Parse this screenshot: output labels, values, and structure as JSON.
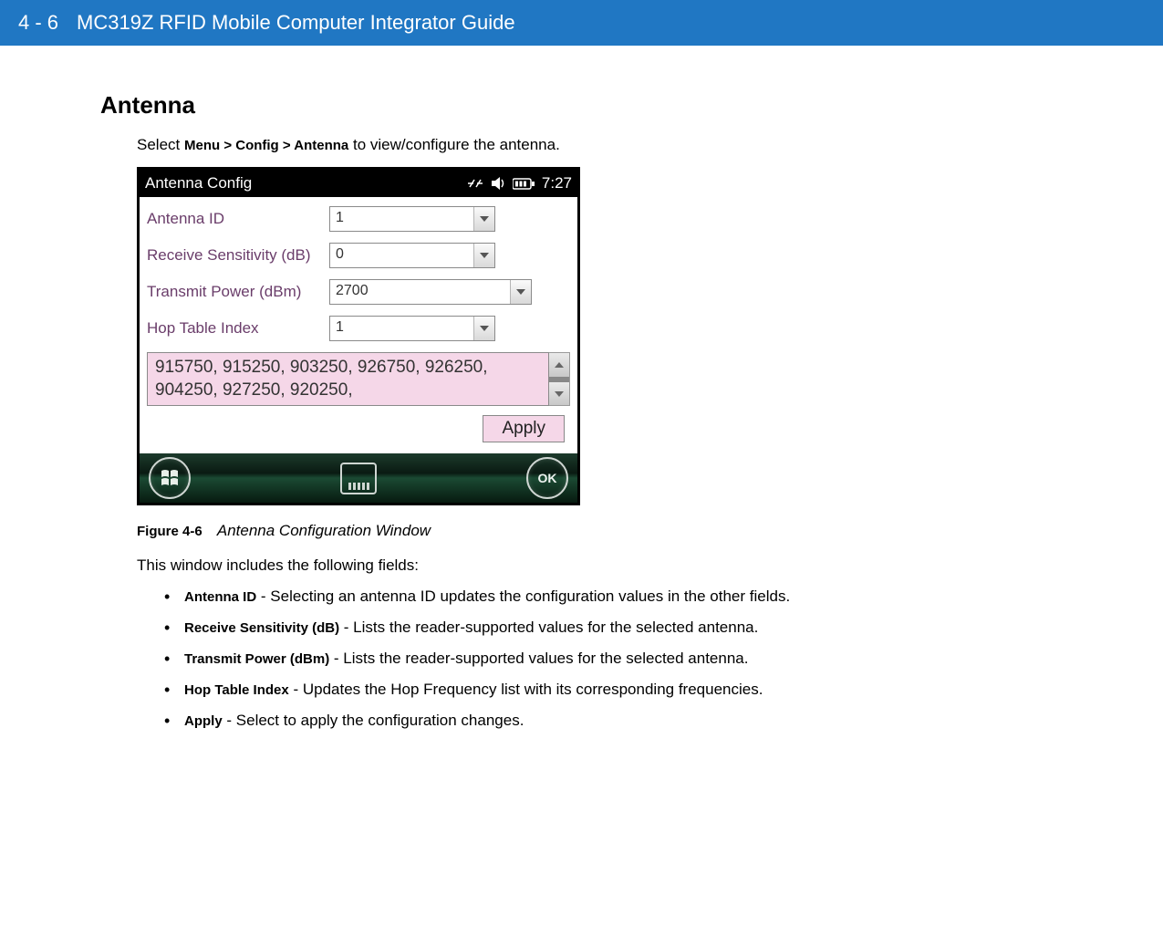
{
  "header": {
    "page": "4 - 6",
    "title": "MC319Z RFID Mobile Computer Integrator Guide"
  },
  "section": {
    "title": "Antenna",
    "intro_prefix": "Select ",
    "intro_bold": "Menu > Config > Antenna",
    "intro_suffix": " to view/configure the antenna."
  },
  "screenshot": {
    "window_title": "Antenna Config",
    "clock": "7:27",
    "fields": {
      "antenna_id": {
        "label": "Antenna ID",
        "value": "1"
      },
      "receive_sens": {
        "label": "Receive Sensitivity (dB)",
        "value": "0"
      },
      "tx_power": {
        "label": "Transmit Power (dBm)",
        "value": "2700"
      },
      "hop_index": {
        "label": "Hop Table Index",
        "value": "1"
      }
    },
    "freq_list": "915750, 915250, 903250, 926750, 926250, 904250, 927250, 920250,",
    "apply_label": "Apply",
    "ok_label": "OK"
  },
  "caption": {
    "label": "Figure 4-6",
    "title": "Antenna Configuration Window"
  },
  "desc": {
    "lead": "This window includes the following fields:",
    "items": [
      {
        "term": "Antenna ID",
        "text": " - Selecting an antenna ID updates the configuration values in the other fields."
      },
      {
        "term": "Receive Sensitivity (dB)",
        "text": " - Lists the reader-supported values for the selected antenna."
      },
      {
        "term": "Transmit Power (dBm)",
        "text": " - Lists the reader-supported values for the selected antenna."
      },
      {
        "term": "Hop Table Index",
        "text": " - Updates the Hop Frequency list with its corresponding frequencies."
      },
      {
        "term": "Apply",
        "text": " - Select to apply the configuration changes."
      }
    ]
  }
}
